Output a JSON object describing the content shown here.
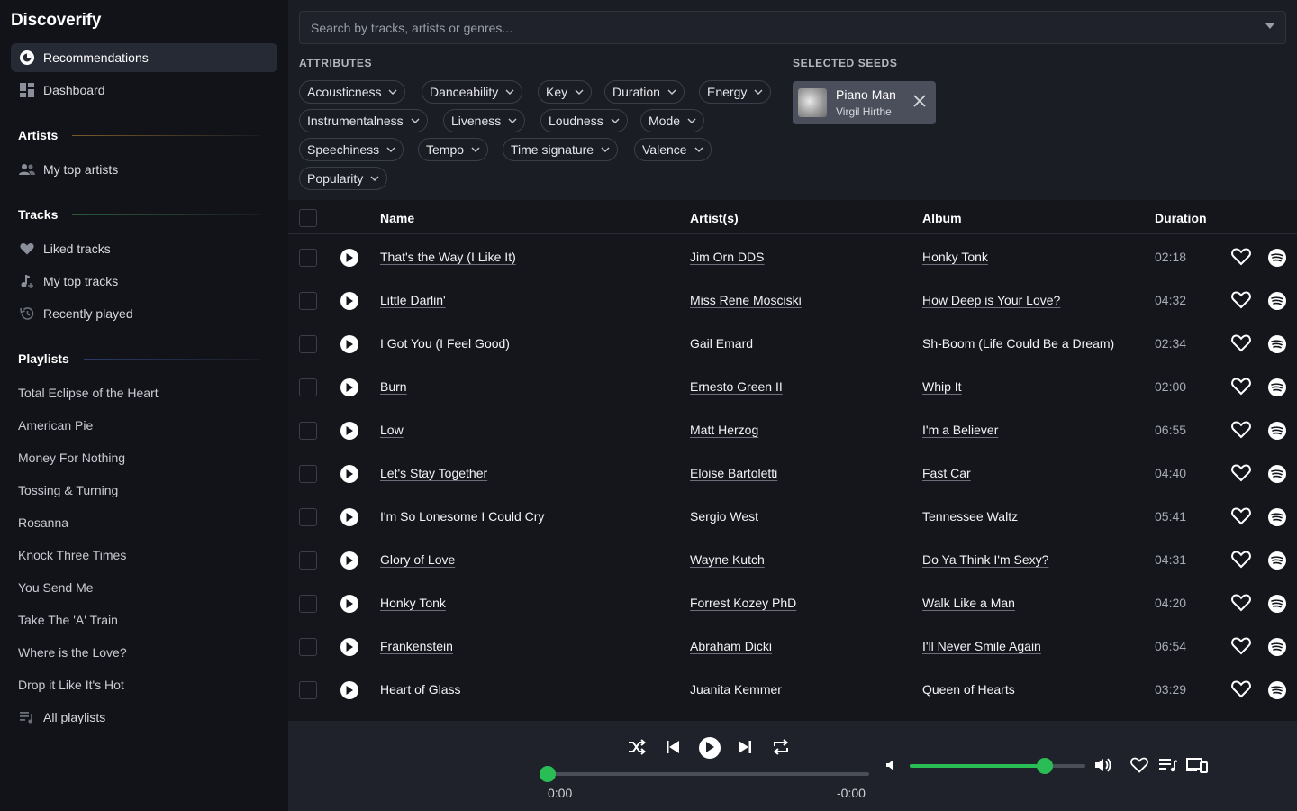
{
  "app": {
    "title": "Discoverify"
  },
  "sidebar": {
    "nav": [
      {
        "label": "Recommendations",
        "icon": "recommendations-icon",
        "active": true
      },
      {
        "label": "Dashboard",
        "icon": "dashboard-icon",
        "active": false
      }
    ],
    "artists": {
      "title": "Artists",
      "items": [
        {
          "label": "My top artists",
          "icon": "people-icon"
        }
      ]
    },
    "tracks": {
      "title": "Tracks",
      "items": [
        {
          "label": "Liked tracks",
          "icon": "heart-icon"
        },
        {
          "label": "My top tracks",
          "icon": "music-note-icon"
        },
        {
          "label": "Recently played",
          "icon": "history-icon"
        }
      ]
    },
    "playlists": {
      "title": "Playlists",
      "items": [
        "Total Eclipse of the Heart",
        "American Pie",
        "Money For Nothing",
        "Tossing & Turning",
        "Rosanna",
        "Knock Three Times",
        "You Send Me",
        "Take The 'A' Train",
        "Where is the Love?",
        "Drop it Like It's Hot"
      ],
      "all_label": "All playlists"
    }
  },
  "search": {
    "placeholder": "Search by tracks, artists or genres..."
  },
  "attributes": {
    "title": "ATTRIBUTES",
    "chips": [
      "Acousticness",
      "Danceability",
      "Key",
      "Duration",
      "Energy",
      "Instrumentalness",
      "Liveness",
      "Loudness",
      "Mode",
      "Speechiness",
      "Tempo",
      "Time signature",
      "Valence",
      "Popularity"
    ]
  },
  "seeds": {
    "title": "SELECTED SEEDS",
    "items": [
      {
        "track": "Piano Man",
        "artist": "Virgil Hirthe"
      }
    ]
  },
  "table": {
    "headers": {
      "name": "Name",
      "artists": "Artist(s)",
      "album": "Album",
      "duration": "Duration"
    },
    "rows": [
      {
        "name": "That's the Way (I Like It)",
        "artist": "Jim Orn DDS",
        "album": "Honky Tonk",
        "duration": "02:18"
      },
      {
        "name": "Little Darlin'",
        "artist": "Miss Rene Mosciski",
        "album": "How Deep is Your Love?",
        "duration": "04:32"
      },
      {
        "name": "I Got You (I Feel Good)",
        "artist": "Gail Emard",
        "album": "Sh-Boom (Life Could Be a Dream)",
        "duration": "02:34"
      },
      {
        "name": "Burn",
        "artist": "Ernesto Green II",
        "album": "Whip It",
        "duration": "02:00"
      },
      {
        "name": "Low",
        "artist": "Matt Herzog",
        "album": "I'm a Believer",
        "duration": "06:55"
      },
      {
        "name": "Let's Stay Together",
        "artist": "Eloise Bartoletti",
        "album": "Fast Car",
        "duration": "04:40"
      },
      {
        "name": "I'm So Lonesome I Could Cry",
        "artist": "Sergio West",
        "album": "Tennessee Waltz",
        "duration": "05:41"
      },
      {
        "name": "Glory of Love",
        "artist": "Wayne Kutch",
        "album": "Do Ya Think I'm Sexy?",
        "duration": "04:31"
      },
      {
        "name": "Honky Tonk",
        "artist": "Forrest Kozey PhD",
        "album": "Walk Like a Man",
        "duration": "04:20"
      },
      {
        "name": "Frankenstein",
        "artist": "Abraham Dicki",
        "album": "I'll Never Smile Again",
        "duration": "06:54"
      },
      {
        "name": "Heart of Glass",
        "artist": "Juanita Kemmer",
        "album": "Queen of Hearts",
        "duration": "03:29"
      }
    ]
  },
  "player": {
    "elapsed": "0:00",
    "remaining": "-0:00",
    "progress": 0,
    "volume": 0.77,
    "accent": "#2bbd55"
  }
}
